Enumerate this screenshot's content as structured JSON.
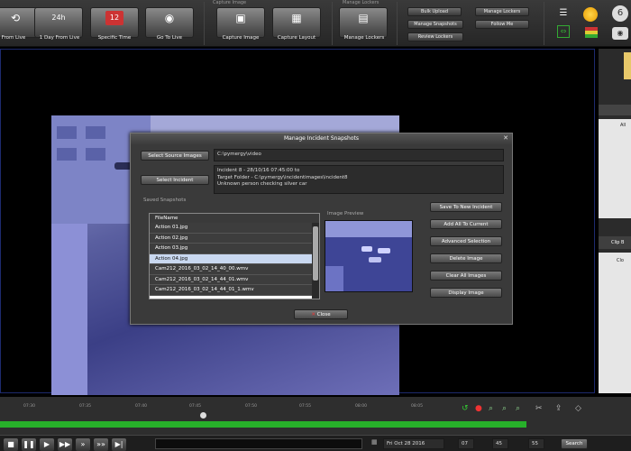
{
  "toolbar": {
    "buttons": [
      {
        "label": "From Live",
        "icon": "clock-rewind-icon",
        "glyph": "⟲"
      },
      {
        "label": "1 Day From Live",
        "icon": "24h-clock-icon",
        "glyph": "24h"
      },
      {
        "label": "Specific Time",
        "icon": "calendar-icon",
        "glyph": "12"
      },
      {
        "label": "Go To Live",
        "icon": "camera-icon",
        "glyph": "◉"
      },
      {
        "label": "Capture Image",
        "icon": "capture-image-icon",
        "glyph": "▣"
      },
      {
        "label": "Capture Layout",
        "icon": "capture-layout-icon",
        "glyph": "▦"
      },
      {
        "label": "Manage Lockers",
        "icon": "lockers-icon",
        "glyph": "▤"
      }
    ],
    "groups": {
      "capture": "Capture Image",
      "lockers": "Manage Lockers"
    },
    "small_buttons": {
      "bulk_upload": "Bulk Upload",
      "manage_lockers": "Manage Lockers",
      "manage_snapshots": "Manage Snapshots",
      "follow_me": "Follow Me",
      "review_lockers": "Review Lockers"
    }
  },
  "dialog": {
    "title": "Manage Incident Snapshots",
    "close_glyph": "✕",
    "select_source_label": "Select Source Images",
    "source_path": "C:\\pymergy\\video",
    "select_incident_label": "Select Incident",
    "incident_info": [
      "Incident 8 - 28/10/16 07:45:00 to",
      "Target Folder - C:\\pymergy\\incidentimages\\incident8",
      "Unknown person checking silver car"
    ],
    "saved_snapshots_label": "Saved Snapshots",
    "image_preview_label": "Image Preview",
    "list_header": "FileName",
    "files": [
      "Action 01.jpg",
      "Action 02.jpg",
      "Action 03.jpg",
      "Action 04.jpg",
      "Cam212_2016_03_02_14_40_00.wmv",
      "Cam212_2016_03_02_14_44_01.wmv",
      "Cam212_2016_03_02_14_44_01_1.wmv"
    ],
    "selected_index": 3,
    "action_buttons": [
      "Save To New Incident",
      "Add All To Current",
      "Advanced Selection",
      "Delete Image",
      "Clear All Images",
      "Display Image"
    ],
    "close_label": "Close"
  },
  "timeline": {
    "ticks": [
      "07:30",
      "07:35",
      "07:40",
      "07:45",
      "07:50",
      "07:55",
      "08:00",
      "08:05"
    ]
  },
  "bottom": {
    "date": "Fri Oct 28 2016",
    "hour": "07",
    "minute": "45",
    "second": "55",
    "search_label": "Search"
  },
  "colors": {
    "accent_green": "#27b02a",
    "selection": "#c9d8f0"
  }
}
